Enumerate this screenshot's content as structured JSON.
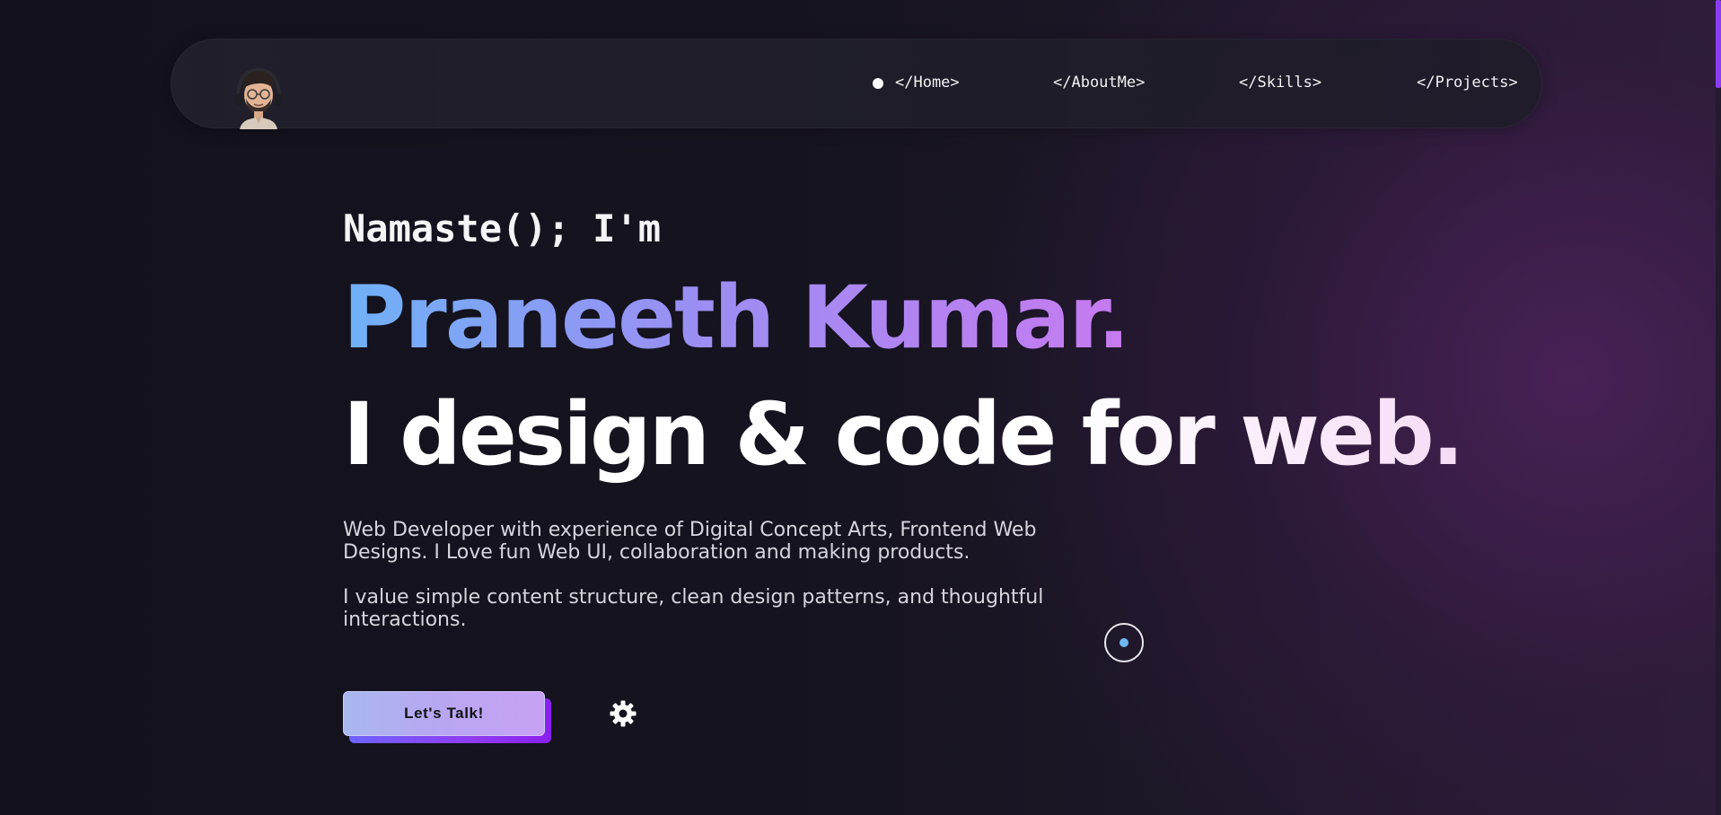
{
  "nav": {
    "links": [
      {
        "label": "</Home>"
      },
      {
        "label": "</AboutMe>"
      },
      {
        "label": "</Skills>"
      },
      {
        "label": "</Projects>"
      }
    ]
  },
  "hero": {
    "greeting": "Namaste(); I'm",
    "name": "Praneeth Kumar.",
    "tagline": "I design & code for web.",
    "description_1": "Web Developer with experience of Digital Concept Arts, Frontend Web Designs. I Love fun Web UI, collaboration and making products.",
    "description_2": "I value simple content structure, clean design patterns, and thoughtful interactions.",
    "cta_label": "Let's Talk!"
  },
  "icons": {
    "settings": "gear-icon",
    "cursor": "cursor-ring-icon",
    "avatar": "avatar"
  },
  "colors": {
    "accent_blue": "#6fb1f7",
    "accent_purple": "#c77af0",
    "cta_shadow": "#8a1ff0",
    "scrollbar_thumb": "#8b3cf0"
  }
}
